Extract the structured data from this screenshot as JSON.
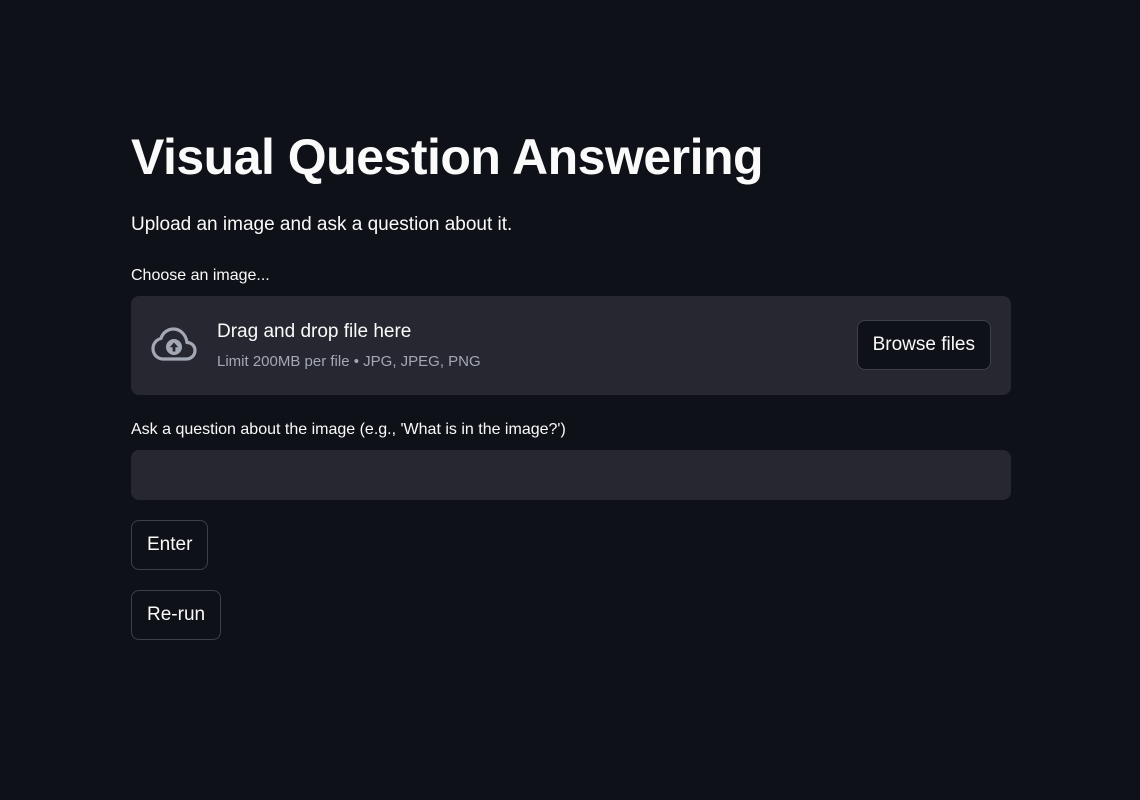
{
  "page": {
    "title": "Visual Question Answering",
    "subtitle": "Upload an image and ask a question about it."
  },
  "uploader": {
    "label": "Choose an image...",
    "drop_text": "Drag and drop file here",
    "limit_text": "Limit 200MB per file • JPG, JPEG, PNG",
    "browse_label": "Browse files",
    "icon": "cloud-upload-icon"
  },
  "question": {
    "label": "Ask a question about the image (e.g., 'What is in the image?')",
    "value": "",
    "placeholder": ""
  },
  "buttons": {
    "enter_label": "Enter",
    "rerun_label": "Re-run"
  },
  "colors": {
    "background": "#0e1117",
    "surface": "#262730",
    "text": "#fafafa",
    "muted_text": "#a3a8b4",
    "border": "#3d4049"
  }
}
